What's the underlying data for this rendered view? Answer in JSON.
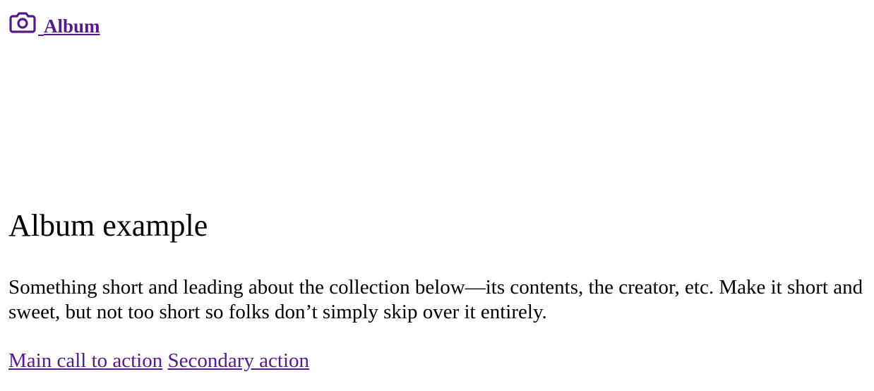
{
  "navbar": {
    "brand_label": "Album",
    "brand_icon": "camera-icon",
    "link_color": "#551a8b"
  },
  "hero": {
    "title": "Album example",
    "lead": "Something short and leading about the collection below—its contents, the creator, etc. Make it short and sweet, but not too short so folks don’t simply skip over it entirely.",
    "primary_action": "Main call to action",
    "secondary_action": "Secondary action"
  }
}
